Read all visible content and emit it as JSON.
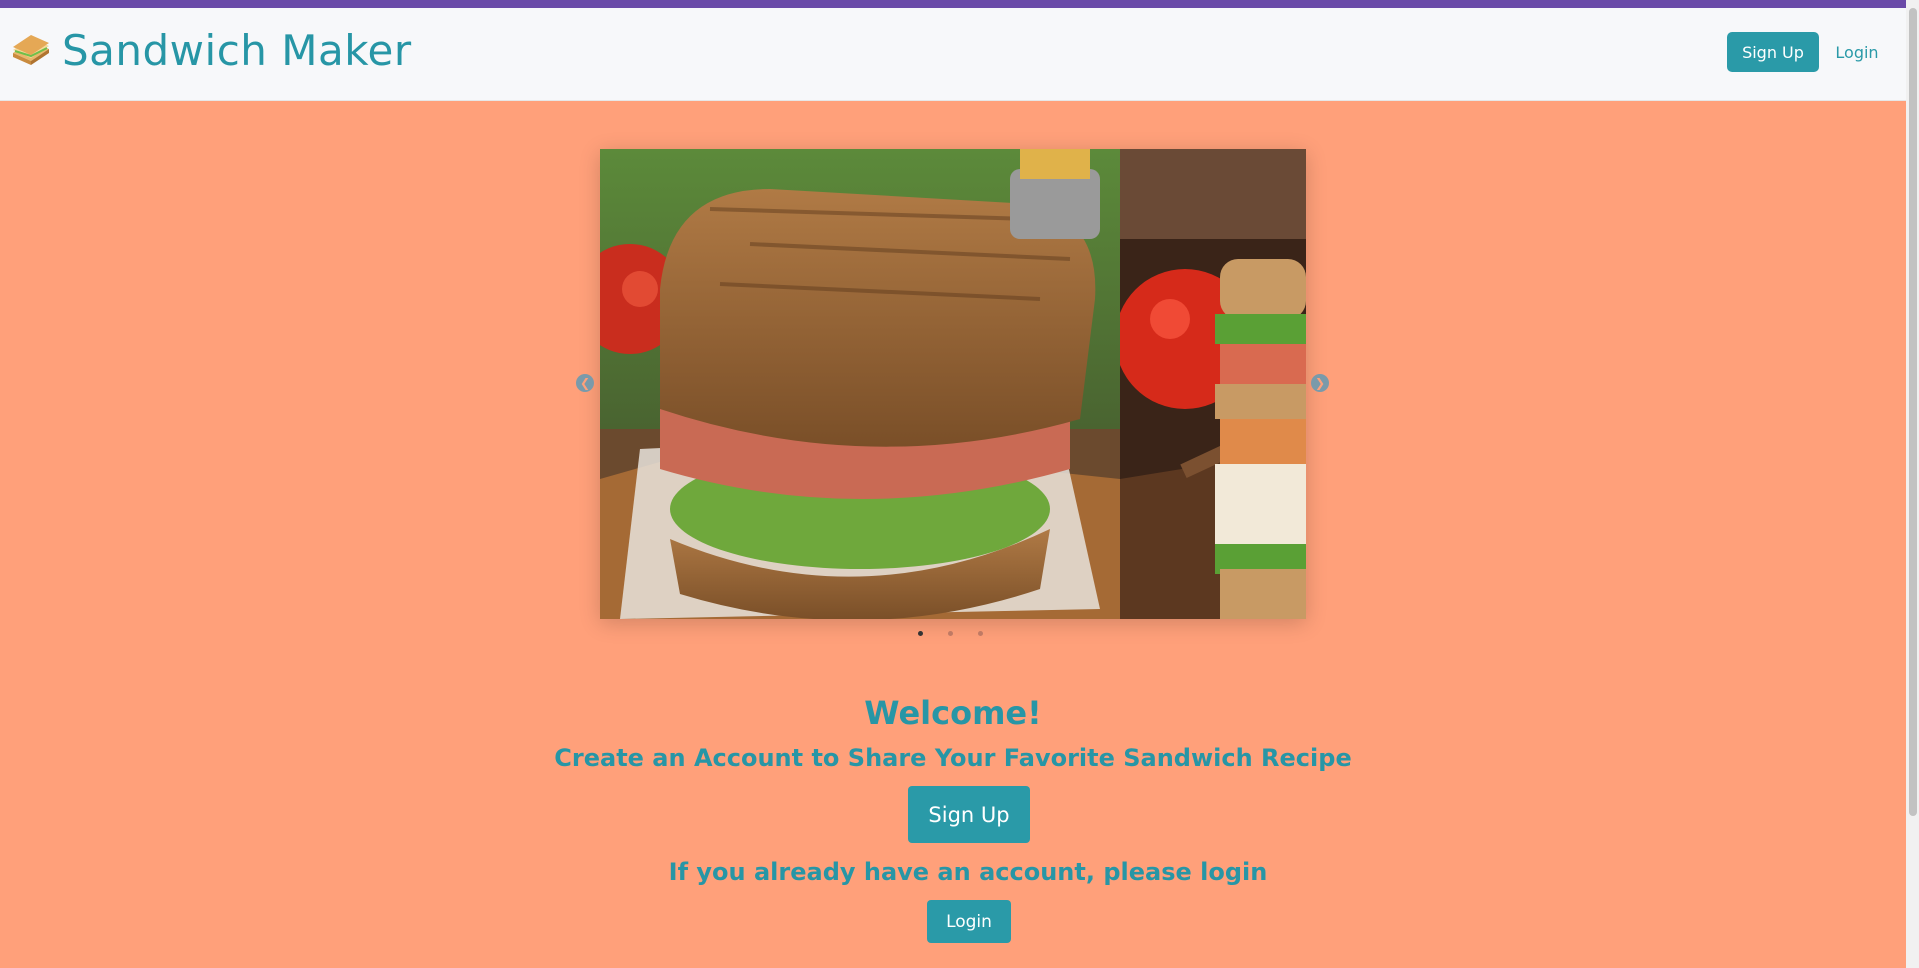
{
  "navbar": {
    "brand": "Sandwich Maker",
    "brand_icon": "sandwich-icon",
    "signup_label": "Sign Up",
    "login_label": "Login"
  },
  "carousel": {
    "slide_count": 3,
    "active_index": 0,
    "prev_icon": "chevron-left-icon",
    "next_icon": "chevron-right-icon"
  },
  "main": {
    "welcome": "Welcome!",
    "subtitle": "Create an Account to Share Your Favorite Sandwich Recipe",
    "signup_label": "Sign Up",
    "already_text": "If you already have an account, please login",
    "login_label": "Login"
  },
  "colors": {
    "background": "#ffa07a",
    "accent": "#2a9aa8",
    "top_stripe": "#6a4aa8"
  }
}
